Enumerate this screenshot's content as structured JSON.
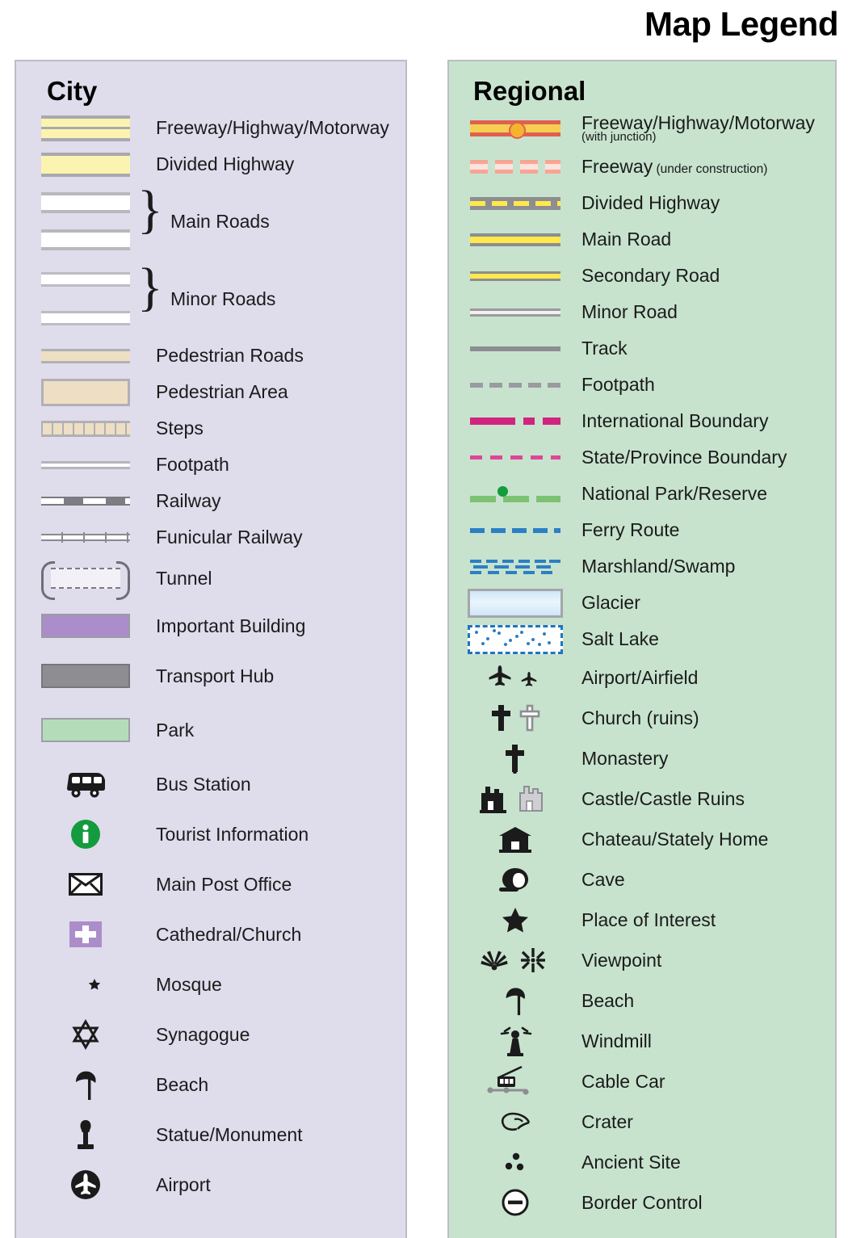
{
  "title": "Map Legend",
  "panels": {
    "city": {
      "heading": "City",
      "background_color": "#dfdcec",
      "items": [
        {
          "label": "Freeway/Highway/Motorway",
          "symbol": "city-freeway-swatch"
        },
        {
          "label": "Divided Highway",
          "symbol": "city-divided-highway-swatch"
        },
        {
          "label": "Main Roads",
          "symbol": "city-main-roads-swatch"
        },
        {
          "label": "Minor Roads",
          "symbol": "city-minor-roads-swatch"
        },
        {
          "label": "Pedestrian Roads",
          "symbol": "city-pedestrian-road-swatch"
        },
        {
          "label": "Pedestrian Area",
          "symbol": "city-pedestrian-area-swatch"
        },
        {
          "label": "Steps",
          "symbol": "city-steps-swatch"
        },
        {
          "label": "Footpath",
          "symbol": "city-footpath-swatch"
        },
        {
          "label": "Railway",
          "symbol": "city-railway-swatch"
        },
        {
          "label": "Funicular Railway",
          "symbol": "city-funicular-railway-swatch"
        },
        {
          "label": "Tunnel",
          "symbol": "city-tunnel-swatch"
        },
        {
          "label": "Important Building",
          "symbol": "city-important-building-swatch"
        },
        {
          "label": "Transport Hub",
          "symbol": "city-transport-hub-swatch"
        },
        {
          "label": "Park",
          "symbol": "city-park-swatch"
        },
        {
          "label": "Bus Station",
          "symbol": "bus-icon"
        },
        {
          "label": "Tourist Information",
          "symbol": "information-icon"
        },
        {
          "label": "Main Post Office",
          "symbol": "envelope-icon"
        },
        {
          "label": "Cathedral/Church",
          "symbol": "cross-square-icon"
        },
        {
          "label": "Mosque",
          "symbol": "crescent-star-icon"
        },
        {
          "label": "Synagogue",
          "symbol": "star-of-david-icon"
        },
        {
          "label": "Beach",
          "symbol": "beach-umbrella-icon"
        },
        {
          "label": "Statue/Monument",
          "symbol": "statue-icon"
        },
        {
          "label": "Airport",
          "symbol": "airplane-circle-icon"
        }
      ],
      "colors": {
        "freeway_fill": "#fbf3b0",
        "road_casing": "#a9a9ae",
        "pedestrian_fill": "#eedfc4",
        "important_building": "#ab8ec9",
        "transport_hub": "#8e8e92",
        "park": "#b4dcb9",
        "tourist_information": "#149b3e"
      }
    },
    "regional": {
      "heading": "Regional",
      "background_color": "#c7e3cd",
      "items": [
        {
          "label": "Freeway/Highway/Motorway",
          "sublabel_block": "(with junction)",
          "symbol": "regional-freeway-junction-line"
        },
        {
          "label": "Freeway",
          "sublabel_inline": " (under construction)",
          "symbol": "regional-freeway-construction-line"
        },
        {
          "label": "Divided Highway",
          "symbol": "regional-divided-highway-line"
        },
        {
          "label": "Main Road",
          "symbol": "regional-main-road-line"
        },
        {
          "label": "Secondary Road",
          "symbol": "regional-secondary-road-line"
        },
        {
          "label": "Minor Road",
          "symbol": "regional-minor-road-line"
        },
        {
          "label": "Track",
          "symbol": "regional-track-line"
        },
        {
          "label": "Footpath",
          "symbol": "regional-footpath-line"
        },
        {
          "label": "International Boundary",
          "symbol": "international-boundary-line"
        },
        {
          "label": "State/Province Boundary",
          "symbol": "state-boundary-line"
        },
        {
          "label": "National Park/Reserve",
          "symbol": "national-park-line"
        },
        {
          "label": "Ferry Route",
          "symbol": "ferry-route-line"
        },
        {
          "label": "Marshland/Swamp",
          "symbol": "marshland-pattern"
        },
        {
          "label": "Glacier",
          "symbol": "glacier-swatch"
        },
        {
          "label": "Salt Lake",
          "symbol": "salt-lake-swatch"
        },
        {
          "label": "Airport/Airfield",
          "symbol": "airplane-pair-icon"
        },
        {
          "label": "Church (ruins)",
          "symbol": "church-cross-pair-icon"
        },
        {
          "label": "Monastery",
          "symbol": "monastery-cross-icon"
        },
        {
          "label": "Castle/Castle Ruins",
          "symbol": "castle-pair-icon"
        },
        {
          "label": "Chateau/Stately Home",
          "symbol": "chateau-icon"
        },
        {
          "label": "Cave",
          "symbol": "cave-icon"
        },
        {
          "label": "Place of Interest",
          "symbol": "star-icon"
        },
        {
          "label": "Viewpoint",
          "symbol": "viewpoint-pair-icon"
        },
        {
          "label": "Beach",
          "symbol": "beach-umbrella-icon"
        },
        {
          "label": "Windmill",
          "symbol": "windmill-icon"
        },
        {
          "label": "Cable Car",
          "symbol": "cable-car-icon"
        },
        {
          "label": "Crater",
          "symbol": "crater-icon"
        },
        {
          "label": "Ancient Site",
          "symbol": "ancient-site-icon"
        },
        {
          "label": "Border Control",
          "symbol": "border-control-icon"
        }
      ],
      "colors": {
        "freeway_casing": "#e0604f",
        "freeway_fill": "#f6cf52",
        "road_yellow": "#ffe94a",
        "international_boundary": "#d1247f",
        "state_boundary": "#e0459a",
        "national_park": "#7cc273",
        "ferry_route": "#2c7fc4",
        "glacier": "#cfe6f7",
        "salt_lake_border": "#1f74c0"
      }
    }
  }
}
